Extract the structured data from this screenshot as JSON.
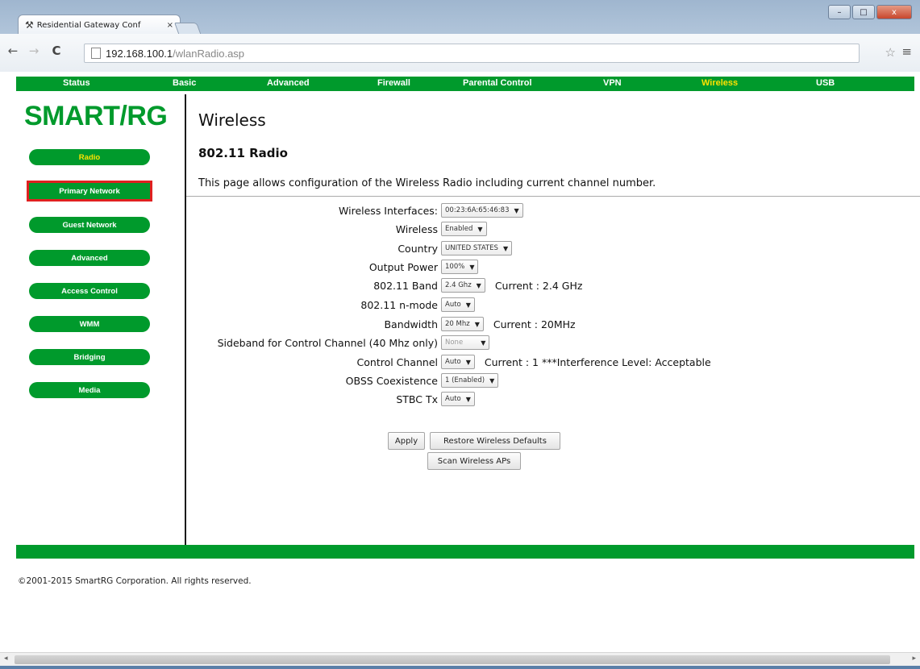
{
  "browser": {
    "tab_title": "Residential Gateway Conf",
    "tab_close": "×",
    "url_host": "192.168.100.1",
    "url_path": "/wlanRadio.asp",
    "back_icon": "←",
    "forward_icon": "→",
    "reload_icon": "C",
    "star_icon": "☆",
    "menu_icon": "≡",
    "min_icon": "–",
    "max_icon": "□",
    "close_icon": "x"
  },
  "topnav": {
    "items": [
      "Status",
      "Basic",
      "Advanced",
      "Firewall",
      "Parental Control",
      "VPN",
      "Wireless",
      "USB"
    ],
    "active": "Wireless"
  },
  "logo": "SMART/RG",
  "sidebar": {
    "items": [
      "Radio",
      "Primary Network",
      "Guest Network",
      "Advanced",
      "Access Control",
      "WMM",
      "Bridging",
      "Media"
    ],
    "active": "Radio",
    "highlighted": "Primary Network"
  },
  "main": {
    "title": "Wireless",
    "subtitle": "802.11 Radio",
    "description": "This page allows configuration of the Wireless Radio including current channel number.",
    "fields": [
      {
        "label": "Wireless Interfaces:",
        "value": "00:23:6A:65:46:83",
        "current": ""
      },
      {
        "label": "Wireless",
        "value": "Enabled",
        "current": ""
      },
      {
        "label": "Country",
        "value": "UNITED STATES",
        "current": ""
      },
      {
        "label": "Output Power",
        "value": "100%",
        "current": ""
      },
      {
        "label": "802.11 Band",
        "value": "2.4 Ghz",
        "current": "Current :  2.4 GHz"
      },
      {
        "label": "802.11 n-mode",
        "value": "Auto",
        "current": ""
      },
      {
        "label": "Bandwidth",
        "value": "20 Mhz",
        "current": "Current :  20MHz"
      },
      {
        "label": "Sideband for Control Channel (40 Mhz only)",
        "value": "None",
        "current": ""
      },
      {
        "label": "Control Channel",
        "value": "Auto",
        "current": "Current :  1 ***Interference Level: Acceptable"
      },
      {
        "label": "OBSS Coexistence",
        "value": "1 (Enabled)",
        "current": ""
      },
      {
        "label": "STBC Tx",
        "value": "Auto",
        "current": ""
      }
    ],
    "buttons": {
      "apply": "Apply",
      "restore": "Restore Wireless Defaults",
      "scan": "Scan Wireless APs"
    }
  },
  "footer": {
    "copyright": "©2001-2015 SmartRG Corporation. All rights reserved."
  },
  "colors": {
    "brand_green": "#009a2c",
    "active_yellow": "#ffe100",
    "highlight_red": "#e02020"
  }
}
